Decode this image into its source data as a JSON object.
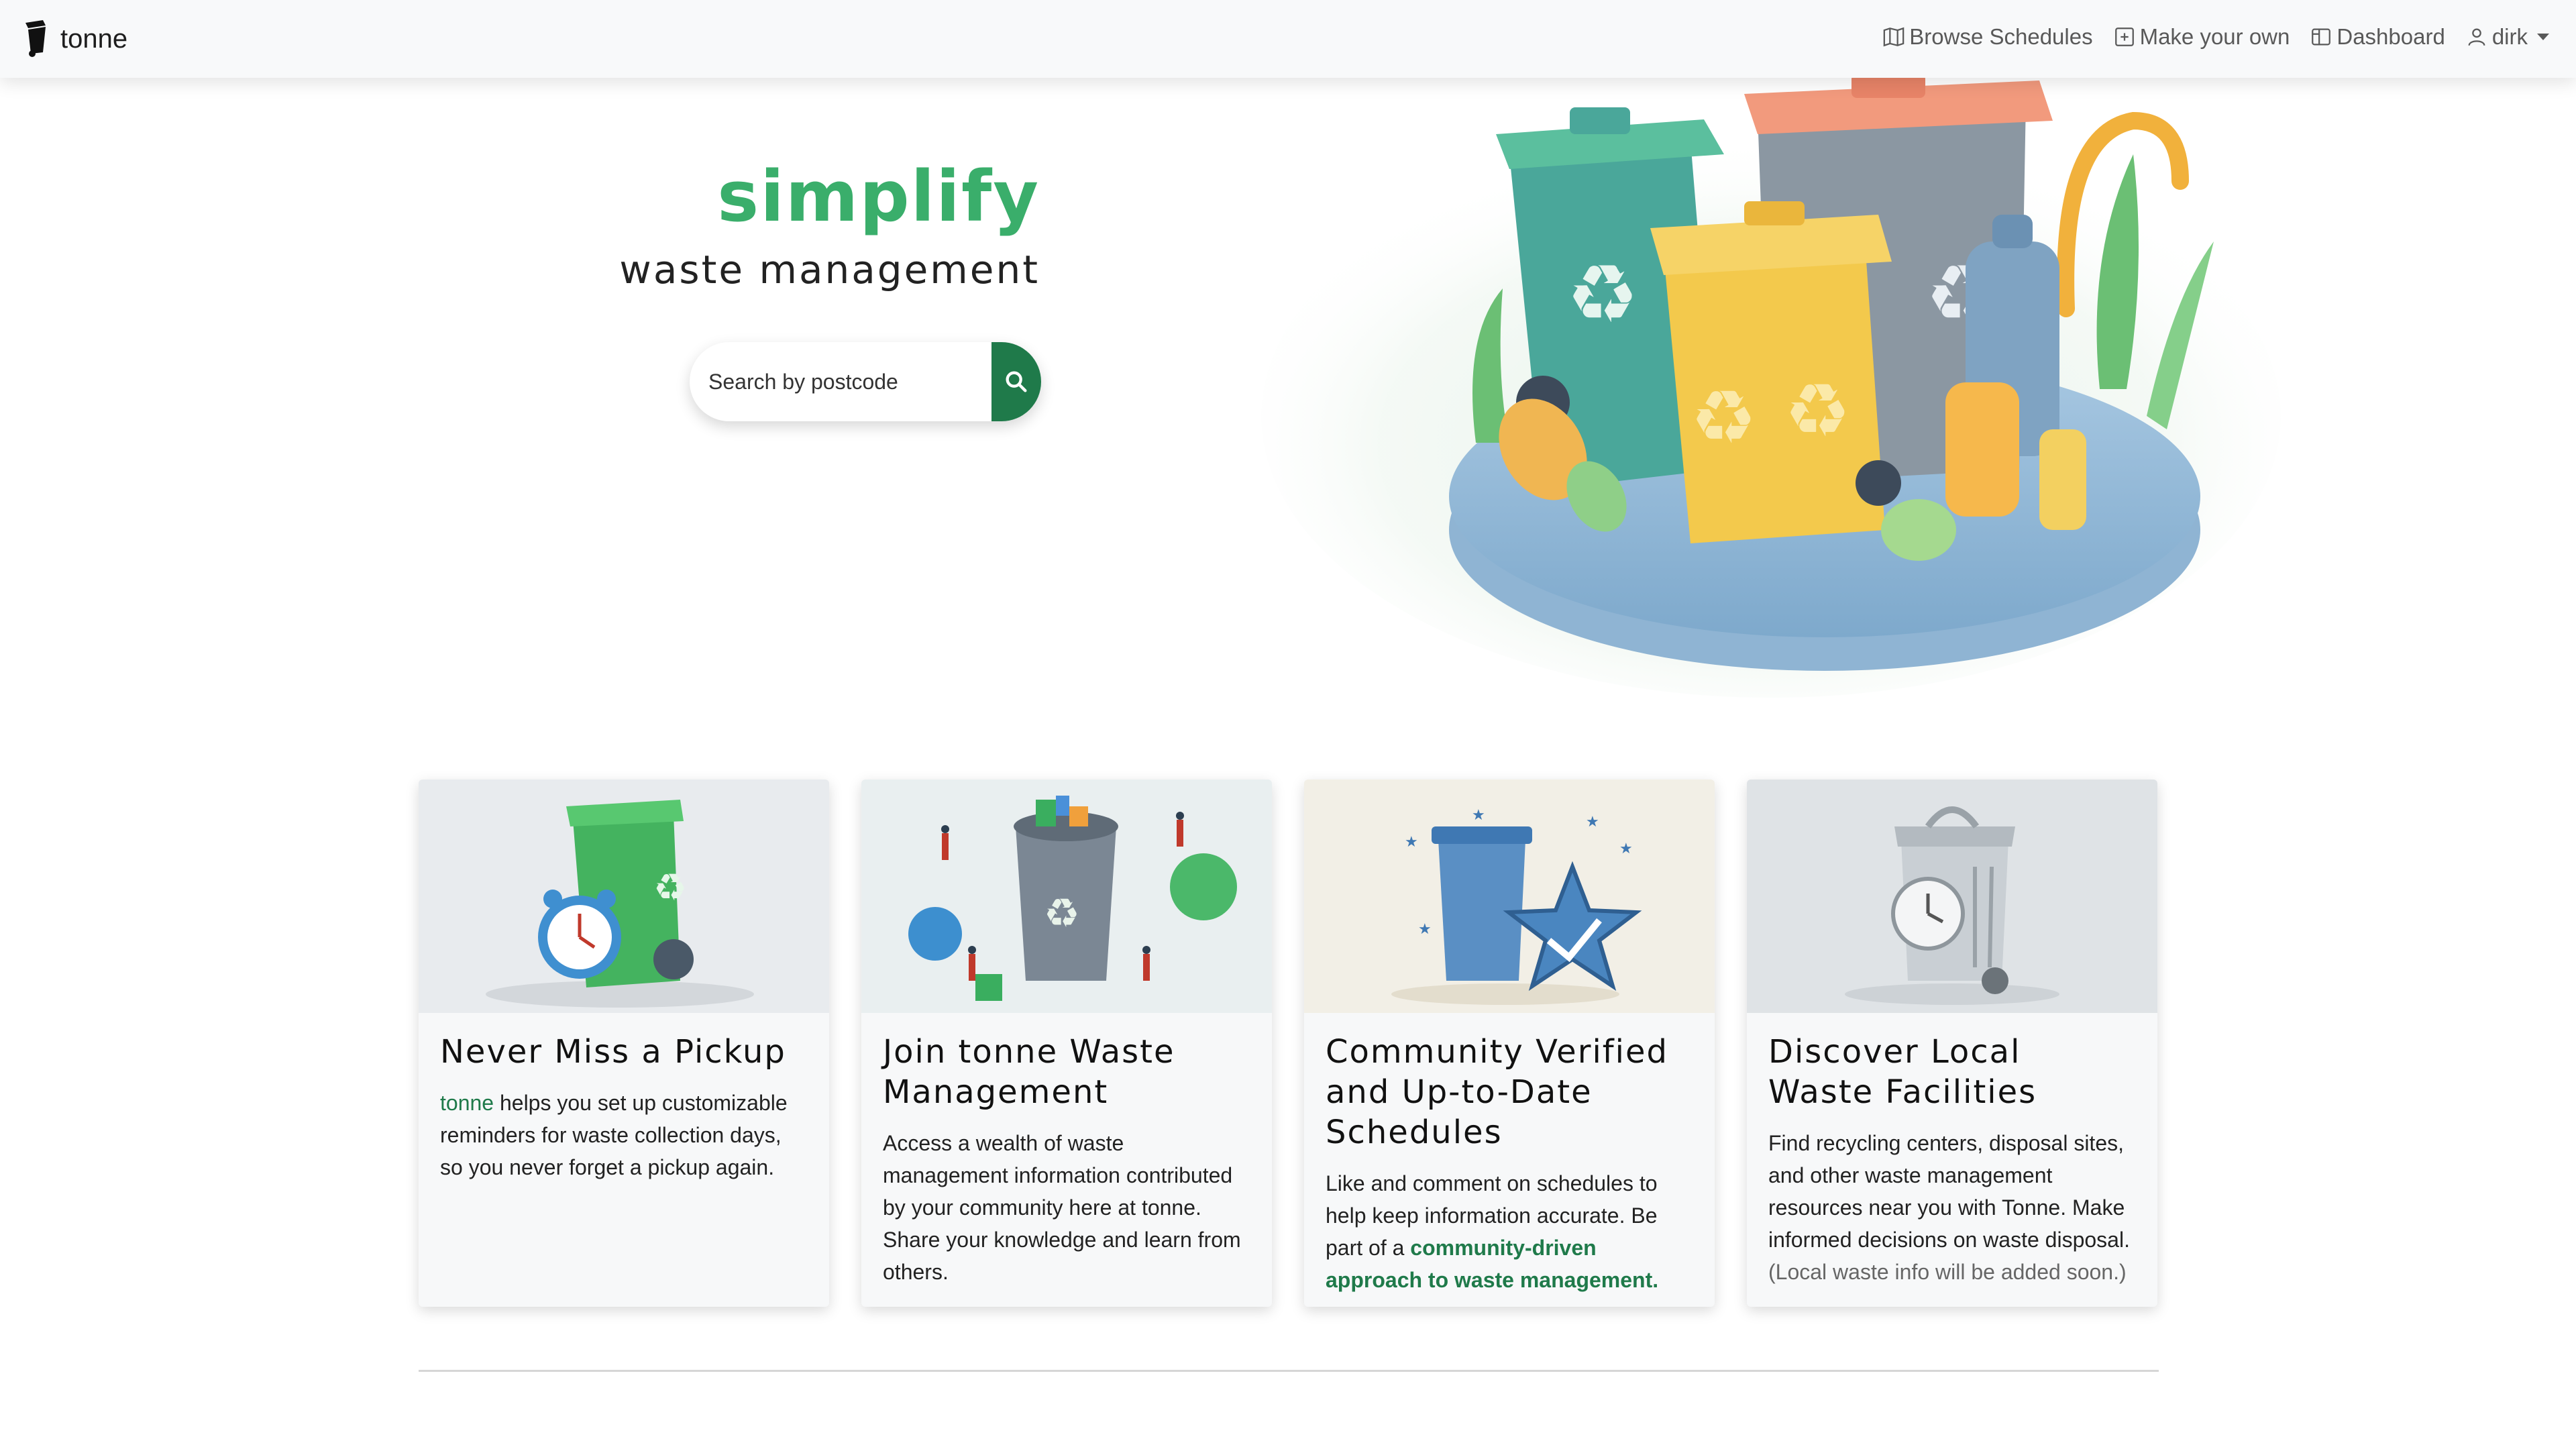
{
  "navbar": {
    "brand": "tonne",
    "links": [
      {
        "label": "Browse Schedules",
        "icon": "map-icon"
      },
      {
        "label": "Make your own",
        "icon": "plus-square-icon"
      },
      {
        "label": "Dashboard",
        "icon": "layout-icon"
      }
    ],
    "user": {
      "label": "dirk",
      "icon": "user-icon"
    }
  },
  "hero": {
    "title": "simplify",
    "subtitle": "waste management",
    "search_placeholder": "Search by postcode",
    "search_icon": "search-icon"
  },
  "cards": [
    {
      "title": "Never Miss a Pickup",
      "brand": "tonne",
      "text": " helps you set up customizable reminders for waste collection days, so you never forget a pickup again."
    },
    {
      "title": "Join tonne Waste Management",
      "text": "Access a wealth of waste management information contributed by your community here at tonne. Share your knowledge and learn from others."
    },
    {
      "title": "Community Verified and Up-to-Date Schedules",
      "text": "Like and comment on schedules to help keep information accurate. Be part of a ",
      "link": "community-driven approach to waste management."
    },
    {
      "title": "Discover Local Waste Facilities",
      "text": "Find recycling centers, disposal sites, and other waste management resources near you with Tonne. Make informed decisions on waste disposal.",
      "note": "(Local waste info will be added soon.)"
    }
  ],
  "colors": {
    "brand_green": "#3aae6b",
    "dark_green": "#1f7a4a",
    "navbar_bg": "#f8f9fa"
  }
}
